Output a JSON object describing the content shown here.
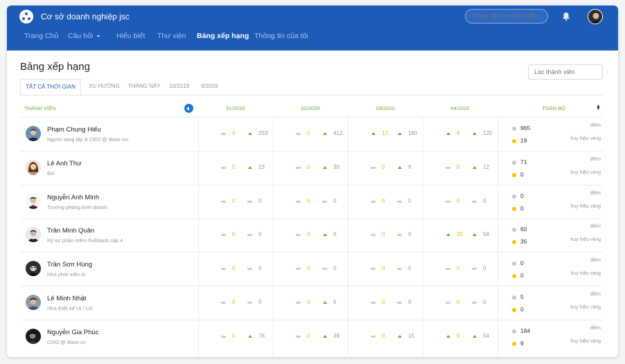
{
  "app": {
    "brand": "Cơ sở doanh nghiệp jsc"
  },
  "header": {
    "search_placeholder": "Nhập để tìm kiếm bất cứ điều gì",
    "nav": [
      {
        "label": "Trang Chủ",
        "active": false
      },
      {
        "label": "Câu hỏi",
        "active": false,
        "has_caret": true
      },
      {
        "label": "Hiểu biết",
        "active": false
      },
      {
        "label": "Thư viện",
        "active": false
      },
      {
        "label": "Bảng xếp hạng",
        "active": true
      },
      {
        "label": "Thông tin của tôi",
        "active": false
      }
    ]
  },
  "page": {
    "title": "Bảng xếp hạng",
    "filter_placeholder": "Lọc thành viên",
    "tabs": [
      "TẤT CẢ THỜI GIAN",
      "XU HƯỚNG",
      "THÁNG NÀY",
      "10/2019",
      "9/2019"
    ],
    "active_tab": 0
  },
  "table": {
    "member_header": "THÀNH VIÊN",
    "months": [
      "01/2020",
      "02/2020",
      "03/2020",
      "04/2020"
    ],
    "total_header": "TOÀN BỘ",
    "points_label": "điểm",
    "badges_label": "huy hiệu vàng",
    "rows": [
      {
        "name": "Phạm Chung Hiếu",
        "subtitle": "Người sáng lập & CEO @ Base inc",
        "avatar": "avatar-photo",
        "months": [
          {
            "badges": "0",
            "points": "253"
          },
          {
            "badges": "0",
            "points": "412"
          },
          {
            "badges": "10",
            "points": "180"
          },
          {
            "badges": "9",
            "points": "120"
          }
        ],
        "total_points": "965",
        "total_badges": "19"
      },
      {
        "name": "Lê Anh Thư",
        "subtitle": "BA",
        "avatar": "avatar-photo",
        "months": [
          {
            "badges": "0",
            "points": "23"
          },
          {
            "badges": "0",
            "points": "30"
          },
          {
            "badges": "0",
            "points": "6"
          },
          {
            "badges": "0",
            "points": "12"
          }
        ],
        "total_points": "71",
        "total_badges": "0"
      },
      {
        "name": "Nguyễn Anh Minh",
        "subtitle": "Trưởng phòng kinh doanh",
        "avatar": "avatar-photo",
        "months": [
          {
            "badges": "0",
            "points": "0"
          },
          {
            "badges": "0",
            "points": "0"
          },
          {
            "badges": "0",
            "points": "0"
          },
          {
            "badges": "0",
            "points": "0"
          }
        ],
        "total_points": "0",
        "total_badges": "0"
      },
      {
        "name": "Trần Minh Quân",
        "subtitle": "Kỹ sư phần mềm Fullstack cấp 4",
        "avatar": "avatar-photo",
        "months": [
          {
            "badges": "0",
            "points": "0"
          },
          {
            "badges": "0",
            "points": "6"
          },
          {
            "badges": "0",
            "points": "0"
          },
          {
            "badges": "35",
            "points": "54"
          }
        ],
        "total_points": "60",
        "total_badges": "35"
      },
      {
        "name": "Trần Sơn Hùng",
        "subtitle": "Nhà phát triển AI",
        "avatar": "avatar-photo",
        "months": [
          {
            "badges": "0",
            "points": "0"
          },
          {
            "badges": "0",
            "points": "0"
          },
          {
            "badges": "0",
            "points": "0"
          },
          {
            "badges": "0",
            "points": "0"
          }
        ],
        "total_points": "0",
        "total_badges": "0"
      },
      {
        "name": "Lê Minh Nhật",
        "subtitle": "Nhà thiết kế UI / UX",
        "avatar": "avatar-photo",
        "months": [
          {
            "badges": "0",
            "points": "0"
          },
          {
            "badges": "0",
            "points": "5"
          },
          {
            "badges": "0",
            "points": "0"
          },
          {
            "badges": "0",
            "points": "0"
          }
        ],
        "total_points": "5",
        "total_badges": "0"
      },
      {
        "name": "Nguyễn Gia Phúc",
        "subtitle": "COO @ Base.vn",
        "avatar": "avatar-photo",
        "months": [
          {
            "badges": "0",
            "points": "76"
          },
          {
            "badges": "0",
            "points": "39"
          },
          {
            "badges": "0",
            "points": "15"
          },
          {
            "badges": "9",
            "points": "54"
          }
        ],
        "total_points": "184",
        "total_badges": "9"
      }
    ]
  },
  "colors": {
    "topbar": "#1d5bb8",
    "accent_green": "#6cae2f",
    "gold": "#f5b800",
    "active_tab": "#1d5bb8"
  },
  "icons": [
    "logo-icon",
    "bell-icon",
    "user-avatar",
    "chevron-left-icon",
    "sort-icon",
    "trend-up-icon",
    "trend-flat-icon"
  ]
}
